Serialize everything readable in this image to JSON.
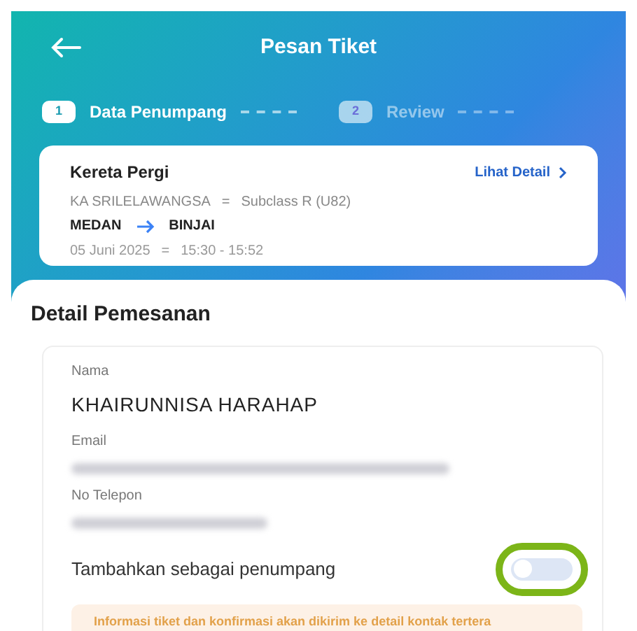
{
  "header": {
    "title": "Pesan Tiket"
  },
  "steps": [
    {
      "number": "1",
      "label": "Data Penumpang",
      "selected": true
    },
    {
      "number": "2",
      "label": "Review",
      "selected": false
    }
  ],
  "trip": {
    "title": "Kereta Pergi",
    "link": "Lihat Detail",
    "train": "KA SRILELAWANGSA",
    "separator_1": "=",
    "subclass": "Subclass R (U82)",
    "origin": "MEDAN",
    "destination": "BINJAI",
    "date": "05 Juni 2025",
    "separator_2": "=",
    "time": "15:30 - 15:52"
  },
  "section_title": "Detail Pemesanan",
  "fields": [
    {
      "label": "Nama",
      "value": "KHAIRUNNISA HARAHAP",
      "redacted": false
    },
    {
      "label": "Email",
      "redacted": true
    },
    {
      "label": "No Telepon",
      "redacted": true
    }
  ],
  "add_passenger": {
    "label": "Tambahkan sebagai penumpang",
    "on": false,
    "highlighted": true
  },
  "notice": "Informasi tiket dan konfirmasi akan dikirim ke detail kontak tertera"
}
